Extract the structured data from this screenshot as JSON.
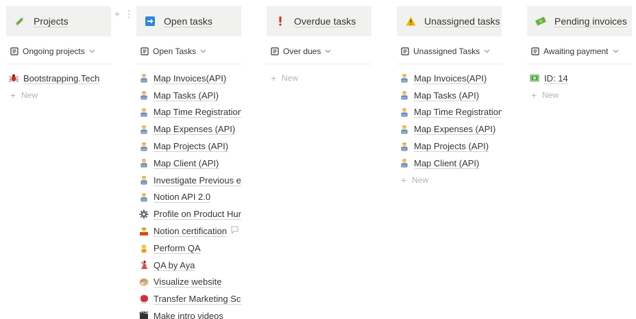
{
  "columns": [
    {
      "title": "Projects",
      "icon": "pencil-icon",
      "view": "Ongoing projects",
      "items": [
        {
          "label": "Bootstrapping.Tech",
          "icon": "bug-icon"
        }
      ],
      "new_label": "New"
    },
    {
      "title": "Open tasks",
      "icon": "arrow-right-box-icon",
      "view": "Open Tasks",
      "items": [
        {
          "label": "Map Invoices(API)",
          "icon": "technologist-icon"
        },
        {
          "label": "Map Tasks (API)",
          "icon": "technologist-icon"
        },
        {
          "label": "Map Time Registration",
          "icon": "technologist-icon"
        },
        {
          "label": "Map Expenses (API)",
          "icon": "technologist-icon"
        },
        {
          "label": "Map Projects (API)",
          "icon": "technologist-icon"
        },
        {
          "label": "Map Client (API)",
          "icon": "technologist-icon"
        },
        {
          "label": "Investigate Previous e",
          "icon": "technologist-icon"
        },
        {
          "label": "Notion API 2.0",
          "icon": "technologist-icon"
        },
        {
          "label": "Profile on Product Hur",
          "icon": "gear-icon"
        },
        {
          "label": "Notion certification",
          "icon": "teacher-icon"
        },
        {
          "label": "Perform QA",
          "icon": "construction-worker-icon"
        },
        {
          "label": "QA by Aya",
          "icon": "dancer-icon"
        },
        {
          "label": "Visualize website",
          "icon": "palette-icon"
        },
        {
          "label": "Transfer Marketing Sch",
          "icon": "boxing-glove-icon"
        },
        {
          "label": "Make intro videos",
          "icon": "film-icon"
        }
      ],
      "new_label": ""
    },
    {
      "title": "Overdue tasks",
      "icon": "exclamation-icon",
      "view": "Over dues",
      "items": [],
      "new_label": "New"
    },
    {
      "title": "Unassigned tasks",
      "icon": "warning-icon",
      "view": "Unassigned Tasks",
      "items": [
        {
          "label": "Map Invoices(API)",
          "icon": "technologist-icon"
        },
        {
          "label": "Map Tasks (API)",
          "icon": "technologist-icon"
        },
        {
          "label": "Map Time Registration",
          "icon": "technologist-icon"
        },
        {
          "label": "Map Expenses (API)",
          "icon": "technologist-icon"
        },
        {
          "label": "Map Projects (API)",
          "icon": "technologist-icon"
        },
        {
          "label": "Map Client (API)",
          "icon": "technologist-icon"
        }
      ],
      "new_label": "New"
    },
    {
      "title": "Pending invoices",
      "icon": "money-icon",
      "view": "Awaiting payment",
      "items": [
        {
          "label": "ID: 14",
          "icon": "dollar-bill-icon"
        }
      ],
      "new_label": "New"
    }
  ],
  "colors": {
    "header_bg": "#f1f1ef",
    "text": "#37352f",
    "muted": "#b4b3b0",
    "open_tasks_icon": "#2e86de",
    "overdue_icon": "#d12e2e",
    "warning_icon": "#f5b400"
  }
}
